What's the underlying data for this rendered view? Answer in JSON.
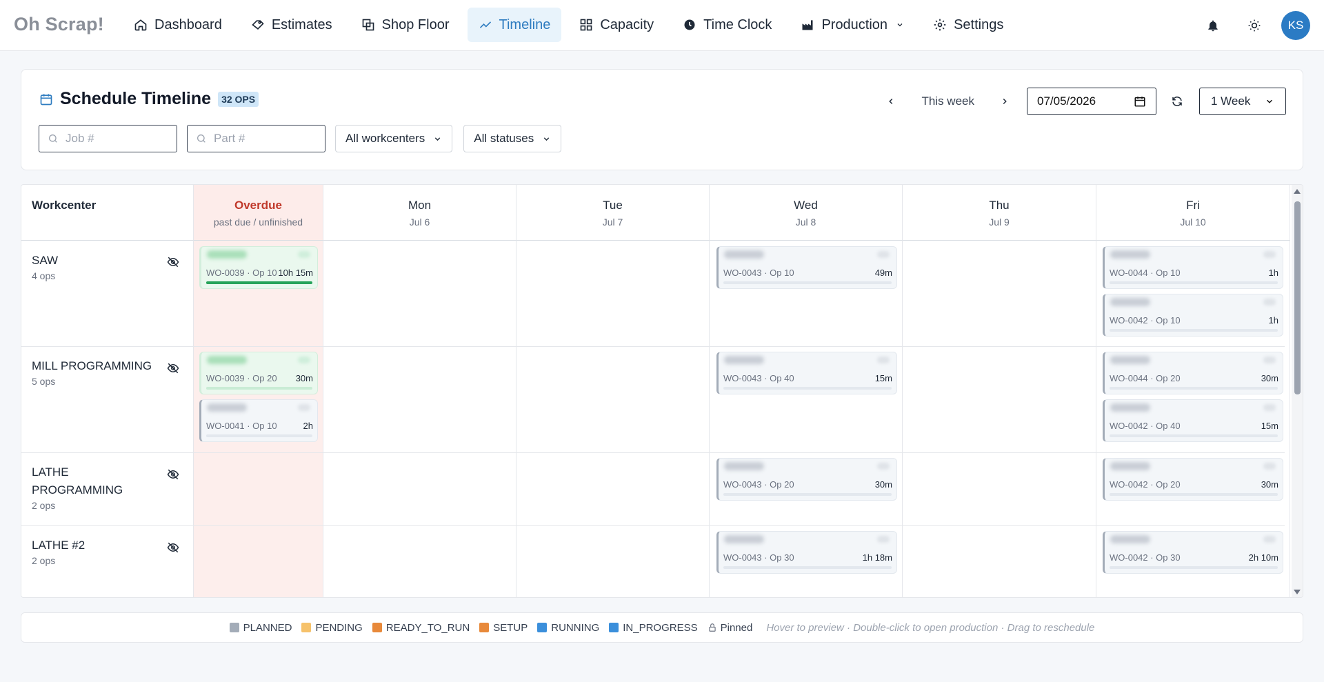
{
  "app": {
    "brand": "Oh Scrap!"
  },
  "nav": {
    "items": [
      {
        "label": "Dashboard",
        "icon": "home-icon"
      },
      {
        "label": "Estimates",
        "icon": "tag-icon"
      },
      {
        "label": "Shop Floor",
        "icon": "layers-icon"
      },
      {
        "label": "Timeline",
        "icon": "trend-line-icon",
        "active": true
      },
      {
        "label": "Capacity",
        "icon": "grid-icon"
      },
      {
        "label": "Time Clock",
        "icon": "clock-icon"
      },
      {
        "label": "Production",
        "icon": "factory-icon",
        "has_dropdown": true
      },
      {
        "label": "Settings",
        "icon": "gear-icon"
      }
    ],
    "user_initials": "KS"
  },
  "header": {
    "title": "Schedule Timeline",
    "ops_badge": "32 OPS",
    "week_label": "This week",
    "date_value": "07/05/2026",
    "range_value": "1 Week"
  },
  "filters": {
    "job_placeholder": "Job #",
    "part_placeholder": "Part #",
    "workcenter_value": "All workcenters",
    "status_value": "All statuses"
  },
  "grid": {
    "workcenter_header": "Workcenter",
    "overdue": {
      "label": "Overdue",
      "sub": "past due / unfinished"
    },
    "days": [
      {
        "day": "Mon",
        "date": "Jul 6"
      },
      {
        "day": "Tue",
        "date": "Jul 7"
      },
      {
        "day": "Wed",
        "date": "Jul 8"
      },
      {
        "day": "Thu",
        "date": "Jul 9"
      },
      {
        "day": "Fri",
        "date": "Jul 10"
      }
    ],
    "rows": [
      {
        "name": "SAW",
        "ops": "4 ops",
        "cards": [
          {
            "col": "overdue",
            "wo": "WO-0039 · Op 10",
            "dur": "10h 15m",
            "status": "green",
            "progress": 1.0
          },
          {
            "col": "Wed",
            "wo": "WO-0043 · Op 10",
            "dur": "49m",
            "status": "planned",
            "progress": 0
          },
          {
            "col": "Fri",
            "wo": "WO-0044 · Op 10",
            "dur": "1h",
            "status": "planned",
            "progress": 0
          },
          {
            "col": "Fri",
            "wo": "WO-0042 · Op 10",
            "dur": "1h",
            "status": "planned",
            "progress": 0
          }
        ]
      },
      {
        "name": "MILL PROGRAMMING",
        "ops": "5 ops",
        "cards": [
          {
            "col": "overdue",
            "wo": "WO-0039 · Op 20",
            "dur": "30m",
            "status": "green",
            "progress": 0
          },
          {
            "col": "overdue",
            "wo": "WO-0041 · Op 10",
            "dur": "2h",
            "status": "planned",
            "progress": 0
          },
          {
            "col": "Wed",
            "wo": "WO-0043 · Op 40",
            "dur": "15m",
            "status": "planned",
            "progress": 0
          },
          {
            "col": "Fri",
            "wo": "WO-0044 · Op 20",
            "dur": "30m",
            "status": "planned",
            "progress": 0
          },
          {
            "col": "Fri",
            "wo": "WO-0042 · Op 40",
            "dur": "15m",
            "status": "planned",
            "progress": 0
          }
        ]
      },
      {
        "name": "LATHE PROGRAMMING",
        "ops": "2 ops",
        "cards": [
          {
            "col": "Wed",
            "wo": "WO-0043 · Op 20",
            "dur": "30m",
            "status": "planned",
            "progress": 0
          },
          {
            "col": "Fri",
            "wo": "WO-0042 · Op 20",
            "dur": "30m",
            "status": "planned",
            "progress": 0
          }
        ]
      },
      {
        "name": "LATHE #2",
        "ops": "2 ops",
        "cards": [
          {
            "col": "Wed",
            "wo": "WO-0043 · Op 30",
            "dur": "1h 18m",
            "status": "planned",
            "progress": 0
          },
          {
            "col": "Fri",
            "wo": "WO-0042 · Op 30",
            "dur": "2h 10m",
            "status": "planned",
            "progress": 0
          }
        ]
      }
    ]
  },
  "legend": {
    "items": [
      {
        "label": "PLANNED",
        "color": "#a3acb8"
      },
      {
        "label": "PENDING",
        "color": "#f6c26b"
      },
      {
        "label": "READY_TO_RUN",
        "color": "#e8893a"
      },
      {
        "label": "SETUP",
        "color": "#e8893a"
      },
      {
        "label": "RUNNING",
        "color": "#3b8fdb"
      },
      {
        "label": "IN_PROGRESS",
        "color": "#3b8fdb"
      }
    ],
    "pinned": "Pinned",
    "hint": "Hover to preview · Double-click to open production · Drag to reschedule"
  },
  "colors": {
    "accent": "#2e7cc0",
    "overdue": "#c0392b",
    "running_green": "#27a35a"
  }
}
